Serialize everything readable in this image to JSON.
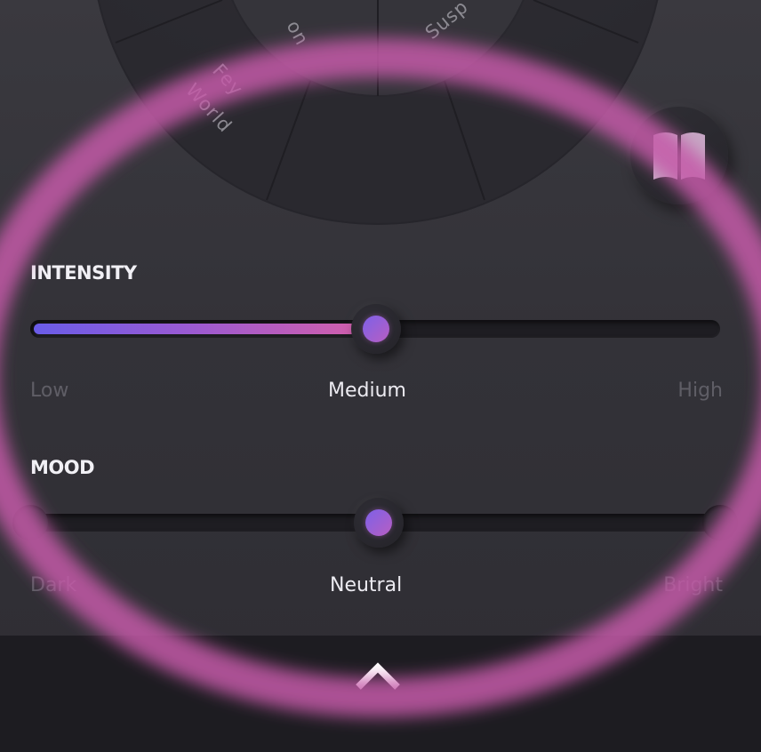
{
  "wheel": {
    "labels": [
      "on",
      "Susp",
      "Fey",
      "World"
    ]
  },
  "book_button": {
    "icon": "book-open-icon",
    "color": "#c6a7c4"
  },
  "intensity": {
    "title": "INTENSITY",
    "labels": {
      "low": "Low",
      "medium": "Medium",
      "high": "High"
    },
    "selected": "Medium",
    "value_fraction": 0.5
  },
  "mood": {
    "title": "MOOD",
    "labels": {
      "dark": "Dark",
      "neutral": "Neutral",
      "bright": "Bright"
    },
    "selected": "Neutral",
    "value_fraction": 0.5
  },
  "bottom_bar": {
    "icon": "chevron-up-icon"
  },
  "colors": {
    "accent_start": "#6a5ce8",
    "accent_end": "#d65fa8",
    "highlight_ring": "#c45aa8",
    "background": "#333238",
    "bottom_bar": "#1d1c21"
  }
}
